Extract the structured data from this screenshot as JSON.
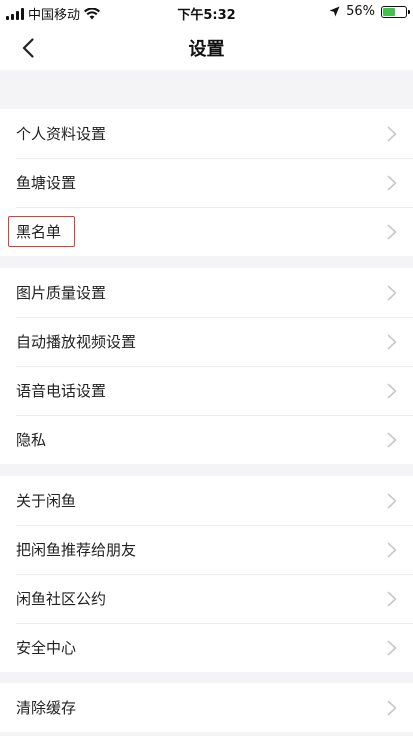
{
  "status_bar": {
    "carrier": "中国移动",
    "time": "下午5:32",
    "battery_percent_text": "56%",
    "battery_level": 0.56
  },
  "nav": {
    "title": "设置"
  },
  "groups": [
    {
      "items": [
        "个人资料设置",
        "鱼塘设置",
        "黑名单"
      ]
    },
    {
      "items": [
        "图片质量设置",
        "自动播放视频设置",
        "语音电话设置",
        "隐私"
      ]
    },
    {
      "items": [
        "关于闲鱼",
        "把闲鱼推荐给朋友",
        "闲鱼社区公约",
        "安全中心"
      ]
    },
    {
      "items": [
        "清除缓存"
      ]
    }
  ],
  "colors": {
    "highlight": "#e53935",
    "battery": "#3fc34a",
    "background": "#f4f4f6"
  }
}
